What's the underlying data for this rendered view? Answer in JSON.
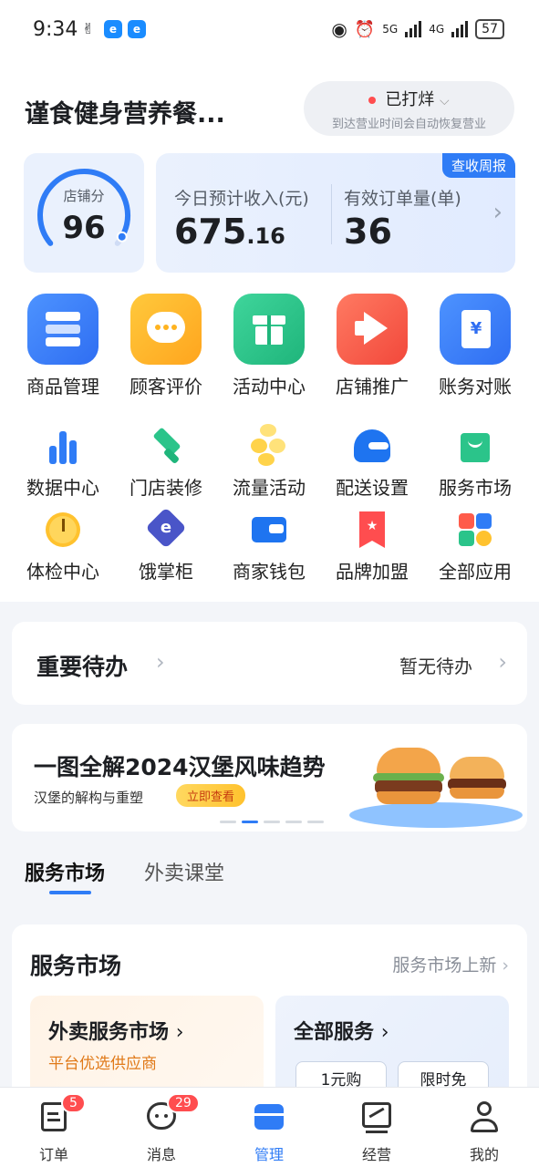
{
  "status_bar": {
    "time": "9:34",
    "network1": "5G",
    "network2": "4G",
    "battery": "57"
  },
  "header": {
    "shop_name": "谨食健身营养餐...",
    "shop_status": "已打烊",
    "shop_status_note": "到达营业时间会自动恢复营业"
  },
  "score": {
    "label": "店铺分",
    "value": "96",
    "fraction": 0.96
  },
  "revenue": {
    "weekly_report": "查收周报",
    "income_label": "今日预计收入(元)",
    "income_int": "675",
    "income_dec": ".16",
    "orders_label": "有效订单量(单)",
    "orders_value": "36"
  },
  "main_tools": [
    {
      "label": "商品管理",
      "icon": "product-icon",
      "color": "#2f7cf6"
    },
    {
      "label": "顾客评价",
      "icon": "comment-icon",
      "color": "#ffb31f"
    },
    {
      "label": "活动中心",
      "icon": "gift-icon",
      "color": "#2bc48a"
    },
    {
      "label": "店铺推广",
      "icon": "megaphone-icon",
      "color": "#ff5b4a"
    },
    {
      "label": "账务对账",
      "icon": "ledger-icon",
      "color": "#2f7cf6"
    }
  ],
  "more_tools": [
    {
      "label": "数据中心",
      "icon": "bar-chart-icon"
    },
    {
      "label": "门店装修",
      "icon": "brush-icon"
    },
    {
      "label": "流量活动",
      "icon": "coins-icon"
    },
    {
      "label": "配送设置",
      "icon": "helmet-icon"
    },
    {
      "label": "服务市场",
      "icon": "shopping-bag-icon"
    },
    {
      "label": "体检中心",
      "icon": "gauge-icon"
    },
    {
      "label": "饿掌柜",
      "icon": "eleme-icon"
    },
    {
      "label": "商家钱包",
      "icon": "wallet-icon"
    },
    {
      "label": "品牌加盟",
      "icon": "star-flag-icon"
    },
    {
      "label": "全部应用",
      "icon": "apps-icon"
    }
  ],
  "todo": {
    "title": "重要待办",
    "empty_text": "暂无待办"
  },
  "banner": {
    "title": "一图全解2024汉堡风味趋势",
    "subtitle": "汉堡的解构与重塑",
    "button": "立即查看",
    "active_dot": 1,
    "dot_count": 5
  },
  "tabs": [
    {
      "label": "服务市场",
      "active": true
    },
    {
      "label": "外卖课堂",
      "active": false
    }
  ],
  "service_market": {
    "title": "服务市场",
    "more": "服务市场上新",
    "card1_title": "外卖服务市场",
    "card1_desc": "平台优选供应商",
    "card2_title": "全部服务",
    "chips": [
      "1元购",
      "限时免"
    ]
  },
  "bottom_nav": [
    {
      "label": "订单",
      "icon": "order-icon",
      "badge": "5"
    },
    {
      "label": "消息",
      "icon": "message-icon",
      "badge": "29"
    },
    {
      "label": "管理",
      "icon": "manage-icon",
      "badge": ""
    },
    {
      "label": "经营",
      "icon": "business-chart-icon",
      "badge": ""
    },
    {
      "label": "我的",
      "icon": "profile-icon",
      "badge": ""
    }
  ]
}
